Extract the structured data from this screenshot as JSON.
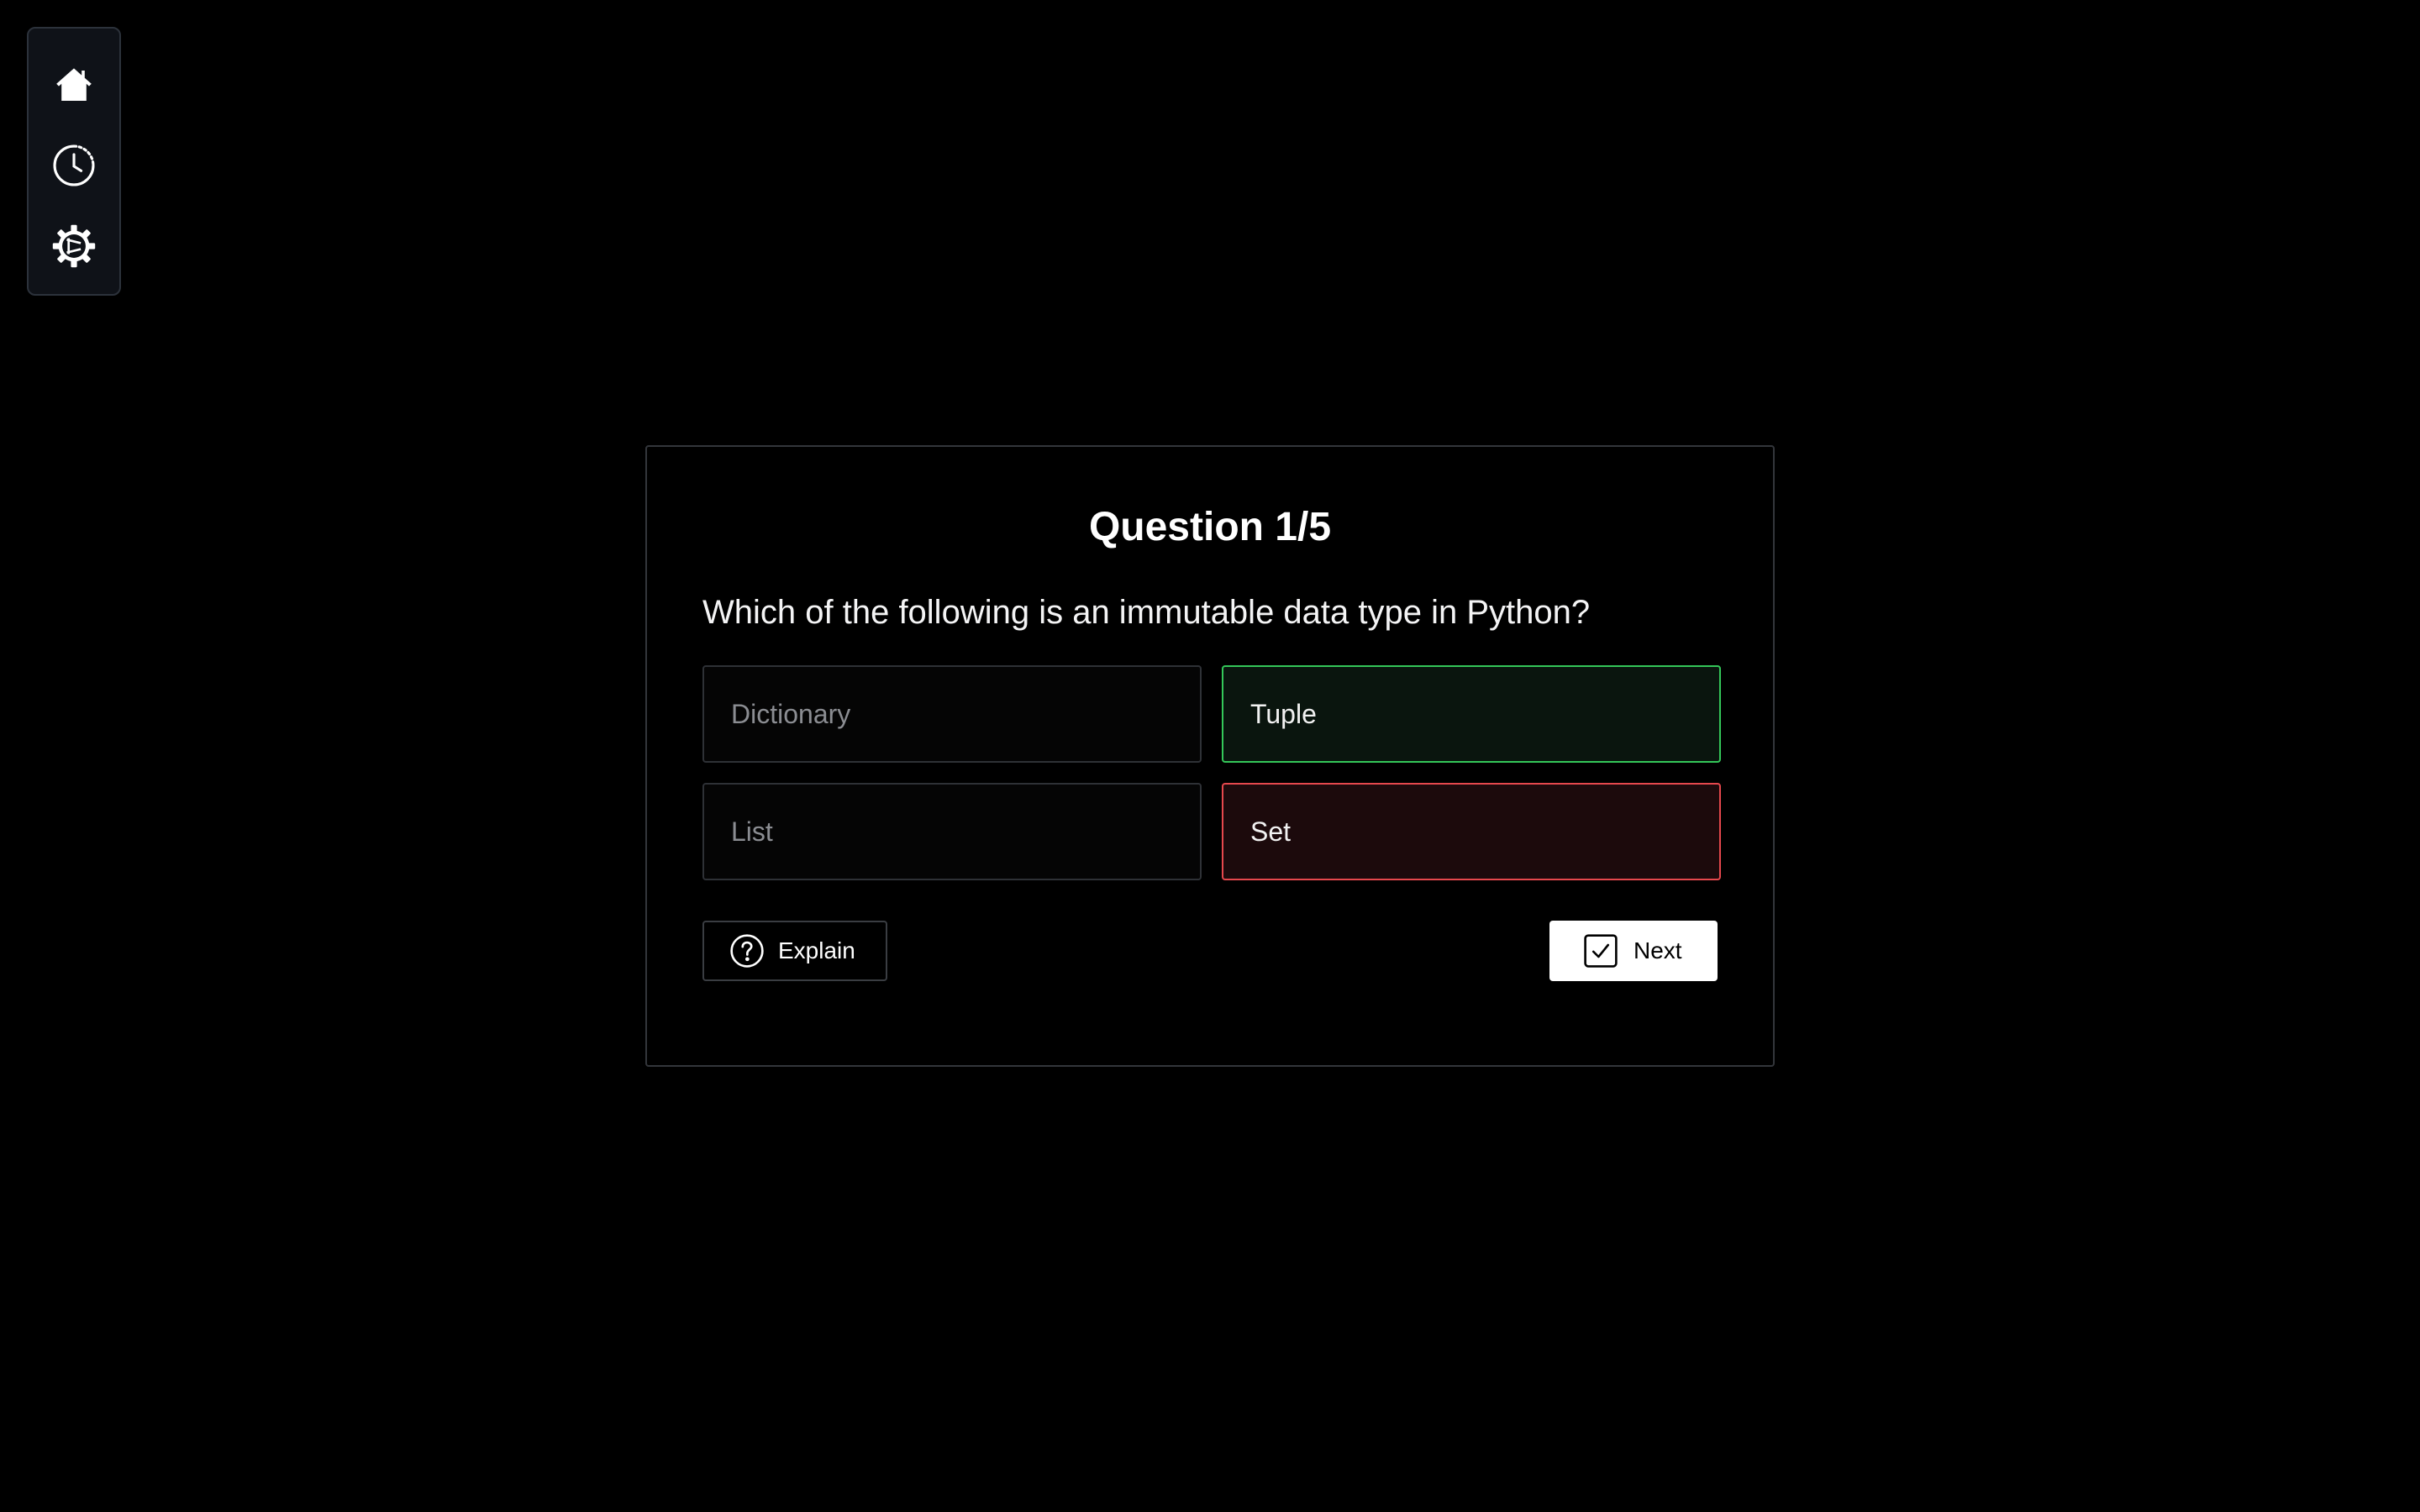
{
  "sidebar": {
    "items": [
      {
        "icon": "home-icon",
        "name": "Home"
      },
      {
        "icon": "history-icon",
        "name": "History"
      },
      {
        "icon": "settings-icon",
        "name": "Settings"
      }
    ]
  },
  "quiz": {
    "title": "Question 1/5",
    "question": "Which of the following is an immutable data type in Python?",
    "options": [
      {
        "label": "Dictionary",
        "state": "neutral"
      },
      {
        "label": "Tuple",
        "state": "correct"
      },
      {
        "label": "List",
        "state": "neutral"
      },
      {
        "label": "Set",
        "state": "wrong"
      }
    ],
    "explain_label": "Explain",
    "next_label": "Next"
  },
  "colors": {
    "background": "#000000",
    "correct": "#34c759",
    "wrong": "#e5484d",
    "sidebar_bg": "#0f1218"
  }
}
